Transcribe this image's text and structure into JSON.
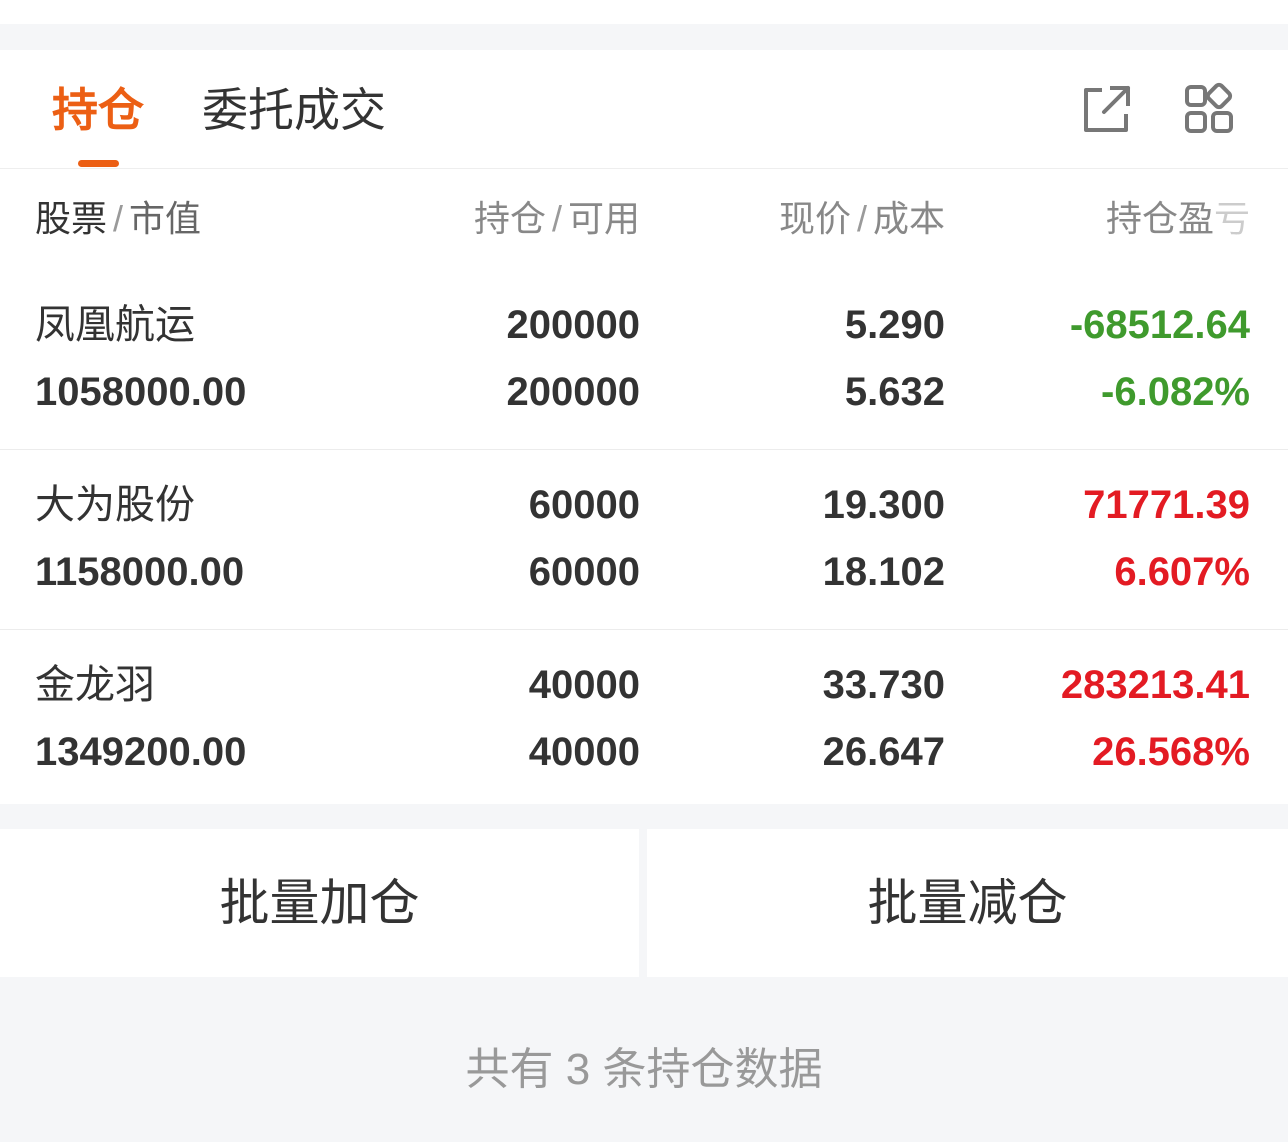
{
  "tabs": {
    "holdings_label": "持仓",
    "orders_label": "委托成交",
    "active": "holdings",
    "accent_color": "#ec5f14"
  },
  "toolbar": {
    "export_icon": "export-icon",
    "grid_icon": "grid-icon"
  },
  "columns": {
    "col1_main": "股票",
    "col1_sub": "市值",
    "col2_main": "持仓",
    "col2_sub": "可用",
    "col3_main": "现价",
    "col3_sub": "成本",
    "col4_main": "持仓盈",
    "col4_fade": "亏",
    "separator": "/"
  },
  "positions": [
    {
      "name": "凤凰航运",
      "market_value": "1058000.00",
      "quantity": "200000",
      "available": "200000",
      "price": "5.290",
      "cost": "5.632",
      "pnl": "-68512.64",
      "pnl_pct": "-6.082%",
      "direction": "loss"
    },
    {
      "name": "大为股份",
      "market_value": "1158000.00",
      "quantity": "60000",
      "available": "60000",
      "price": "19.300",
      "cost": "18.102",
      "pnl": "71771.39",
      "pnl_pct": "6.607%",
      "direction": "gain"
    },
    {
      "name": "金龙羽",
      "market_value": "1349200.00",
      "quantity": "40000",
      "available": "40000",
      "price": "33.730",
      "cost": "26.647",
      "pnl": "283213.41",
      "pnl_pct": "26.568%",
      "direction": "gain"
    }
  ],
  "actions": {
    "batch_add": "批量加仓",
    "batch_reduce": "批量减仓"
  },
  "footer": {
    "summary": "共有 3 条持仓数据"
  },
  "colors": {
    "gain": "#e31b23",
    "loss": "#3f9a2d"
  }
}
